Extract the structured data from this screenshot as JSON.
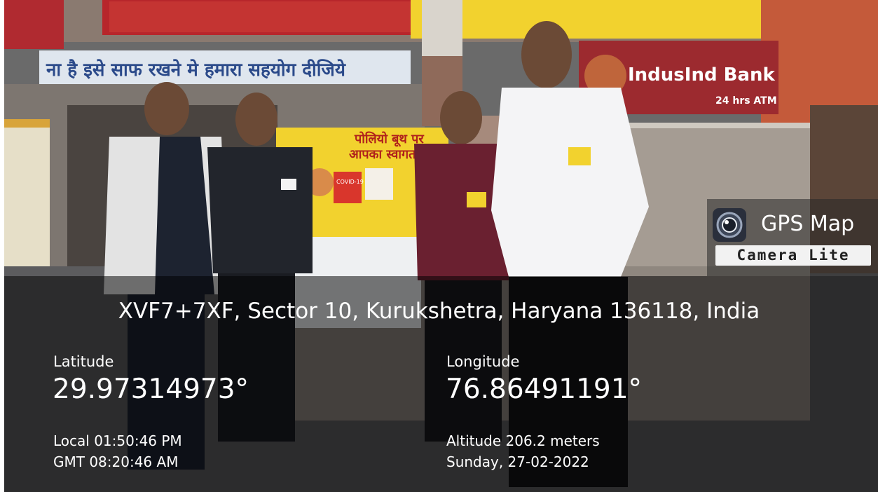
{
  "badge": {
    "title": "GPS Map",
    "subtitle": "Camera Lite",
    "icon": "camera-lens-icon"
  },
  "overlay": {
    "address": "XVF7+7XF, Sector 10, Kurukshetra, Haryana 136118, India",
    "latitude_label": "Latitude",
    "latitude_value": "29.97314973°",
    "longitude_label": "Longitude",
    "longitude_value": "76.86491191°",
    "local_time": "Local 01:50:46 PM",
    "gmt_time": "GMT 08:20:46 AM",
    "altitude": "Altitude 206.2 meters",
    "date": "Sunday, 27-02-2022"
  },
  "scene_signs": {
    "banner_hindi": "ना है इसे साफ रखने मे हमारा सहयोग दीजिये",
    "bank_name": "IndusInd Bank",
    "bank_atm": "24 hrs ATM",
    "poster_line1": "पोलियो बूथ पर",
    "poster_line2": "आपका स्वागत है",
    "poster_covid": "COVID-19"
  },
  "colors": {
    "overlay_bg": "#000000",
    "text": "#ffffff",
    "bank_red": "#9c2a2f",
    "poster_yellow": "#f2d22e"
  }
}
